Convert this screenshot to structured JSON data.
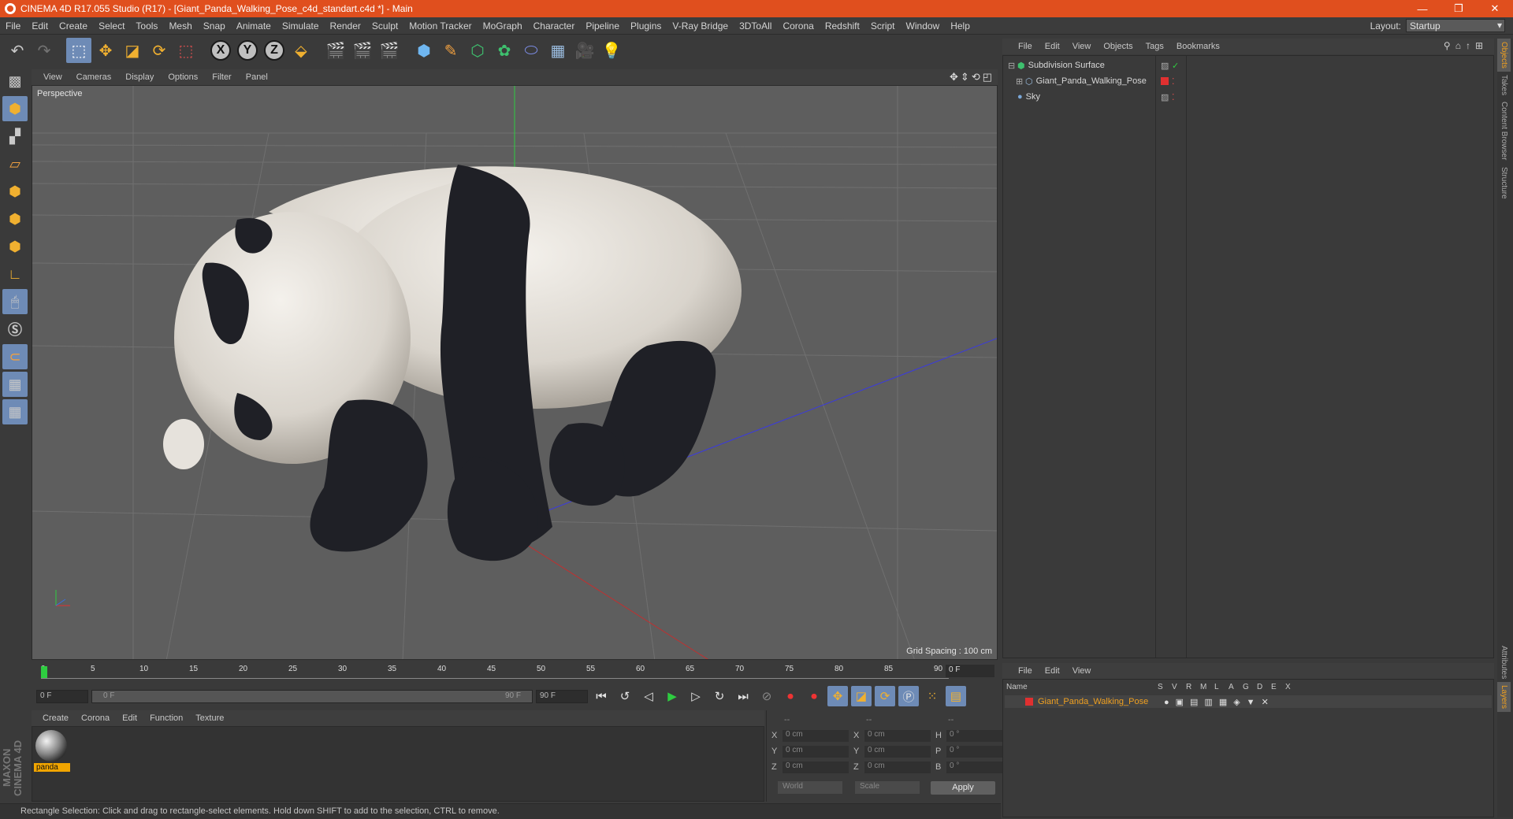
{
  "titlebar": {
    "title": "CINEMA 4D R17.055 Studio (R17) - [Giant_Panda_Walking_Pose_c4d_standart.c4d *] - Main",
    "minimize": "—",
    "restore": "❐",
    "close": "✕"
  },
  "menubar": {
    "items": [
      "File",
      "Edit",
      "Create",
      "Select",
      "Tools",
      "Mesh",
      "Snap",
      "Animate",
      "Simulate",
      "Render",
      "Sculpt",
      "Motion Tracker",
      "MoGraph",
      "Character",
      "Pipeline",
      "Plugins",
      "V-Ray Bridge",
      "3DToAll",
      "Corona",
      "Redshift",
      "Script",
      "Window",
      "Help"
    ],
    "layout_label": "Layout:",
    "layout_value": "Startup"
  },
  "toolbar": {
    "axis_x": "X",
    "axis_y": "Y",
    "axis_z": "Z"
  },
  "viewport": {
    "menu": [
      "View",
      "Cameras",
      "Display",
      "Options",
      "Filter",
      "Panel"
    ],
    "label": "Perspective",
    "grid_spacing": "Grid Spacing : 100 cm",
    "nav_icons": "✥⇕⟲◰"
  },
  "timeline": {
    "ticks": [
      "0",
      "5",
      "10",
      "15",
      "20",
      "25",
      "30",
      "35",
      "40",
      "45",
      "50",
      "55",
      "60",
      "65",
      "70",
      "75",
      "80",
      "85",
      "90"
    ],
    "current_frame": "0 F",
    "start_field": "0 F",
    "range_start": "0 F",
    "range_end": "90 F",
    "end_field": "90 F"
  },
  "material_manager": {
    "menu": [
      "Create",
      "Corona",
      "Edit",
      "Function",
      "Texture"
    ],
    "material_name": "panda"
  },
  "coordinates": {
    "header_dashes": [
      "--",
      "--",
      "--"
    ],
    "rows": [
      {
        "a": "X",
        "av": "0 cm",
        "b": "X",
        "bv": "0 cm",
        "c": "H",
        "cv": "0 °"
      },
      {
        "a": "Y",
        "av": "0 cm",
        "b": "Y",
        "bv": "0 cm",
        "c": "P",
        "cv": "0 °"
      },
      {
        "a": "Z",
        "av": "0 cm",
        "b": "Z",
        "bv": "0 cm",
        "c": "B",
        "cv": "0 °"
      }
    ],
    "world": "World",
    "scale": "Scale",
    "apply": "Apply"
  },
  "status": "Rectangle Selection: Click and drag to rectangle-select elements. Hold down SHIFT to add to the selection, CTRL to remove.",
  "object_manager": {
    "menu": [
      "File",
      "Edit",
      "View",
      "Objects",
      "Tags",
      "Bookmarks"
    ],
    "objects": [
      {
        "name": "Subdivision Surface",
        "icon_color": "#3ec06e"
      },
      {
        "name": "Giant_Panda_Walking_Pose",
        "icon_color": "#9bbde0"
      },
      {
        "name": "Sky",
        "icon_color": "#7aa7d8"
      }
    ]
  },
  "layers": {
    "menu": [
      "File",
      "Edit",
      "View"
    ],
    "columns": [
      "Name",
      "S",
      "V",
      "R",
      "M",
      "L",
      "A",
      "G",
      "D",
      "E",
      "X"
    ],
    "layer_name": "Giant_Panda_Walking_Pose",
    "layer_color": "#e03030"
  },
  "side_tabs": [
    "Objects",
    "Takes",
    "Content Browser",
    "Structure",
    "Attributes",
    "Layers"
  ],
  "maxon": "MAXON CINEMA 4D",
  "colors": {
    "accent": "#e04f1e",
    "highlight": "#6e8bb6",
    "material_tag": "#f1a500"
  }
}
